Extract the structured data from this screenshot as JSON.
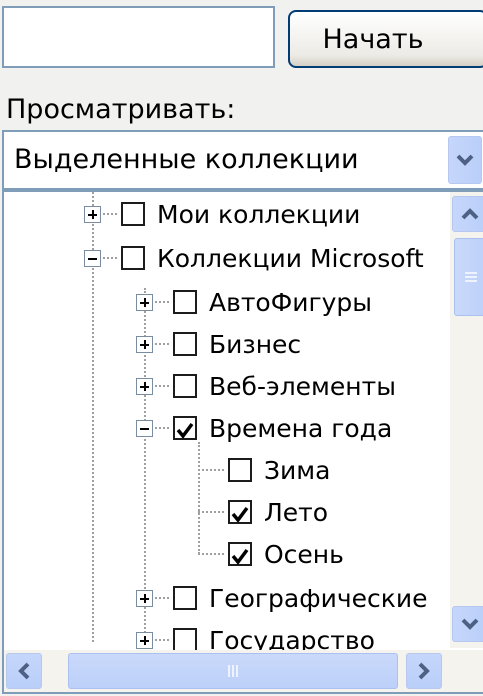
{
  "search": {
    "value": "",
    "go_label": "Начать"
  },
  "browse": {
    "label": "Просматривать:",
    "selected": "Выделенные коллекции"
  },
  "tree": {
    "items": [
      {
        "label": "Мои коллекции",
        "expander": "plus",
        "checked": false
      },
      {
        "label": "Коллекции Microsoft",
        "expander": "minus",
        "checked": false
      },
      {
        "label": "АвтоФигуры",
        "expander": "plus",
        "checked": false
      },
      {
        "label": "Бизнес",
        "expander": "plus",
        "checked": false
      },
      {
        "label": "Веб-элементы",
        "expander": "plus",
        "checked": false
      },
      {
        "label": "Времена года",
        "expander": "minus",
        "checked": true
      },
      {
        "label": "Зима",
        "expander": "none",
        "checked": false
      },
      {
        "label": "Лето",
        "expander": "none",
        "checked": true
      },
      {
        "label": "Осень",
        "expander": "none",
        "checked": true
      },
      {
        "label": "Географические",
        "expander": "plus",
        "checked": false
      },
      {
        "label": "Государство",
        "expander": "plus",
        "checked": false
      }
    ]
  },
  "icons": {
    "combo": "chevron-down-icon",
    "scroll_up": "chevron-up-icon",
    "scroll_down": "chevron-down-icon",
    "scroll_left": "chevron-left-icon",
    "scroll_right": "chevron-right-icon"
  },
  "colors": {
    "accent": "#7f9db9",
    "scroll_blue": "#c6d6fb",
    "icon_blue": "#4d6185"
  }
}
